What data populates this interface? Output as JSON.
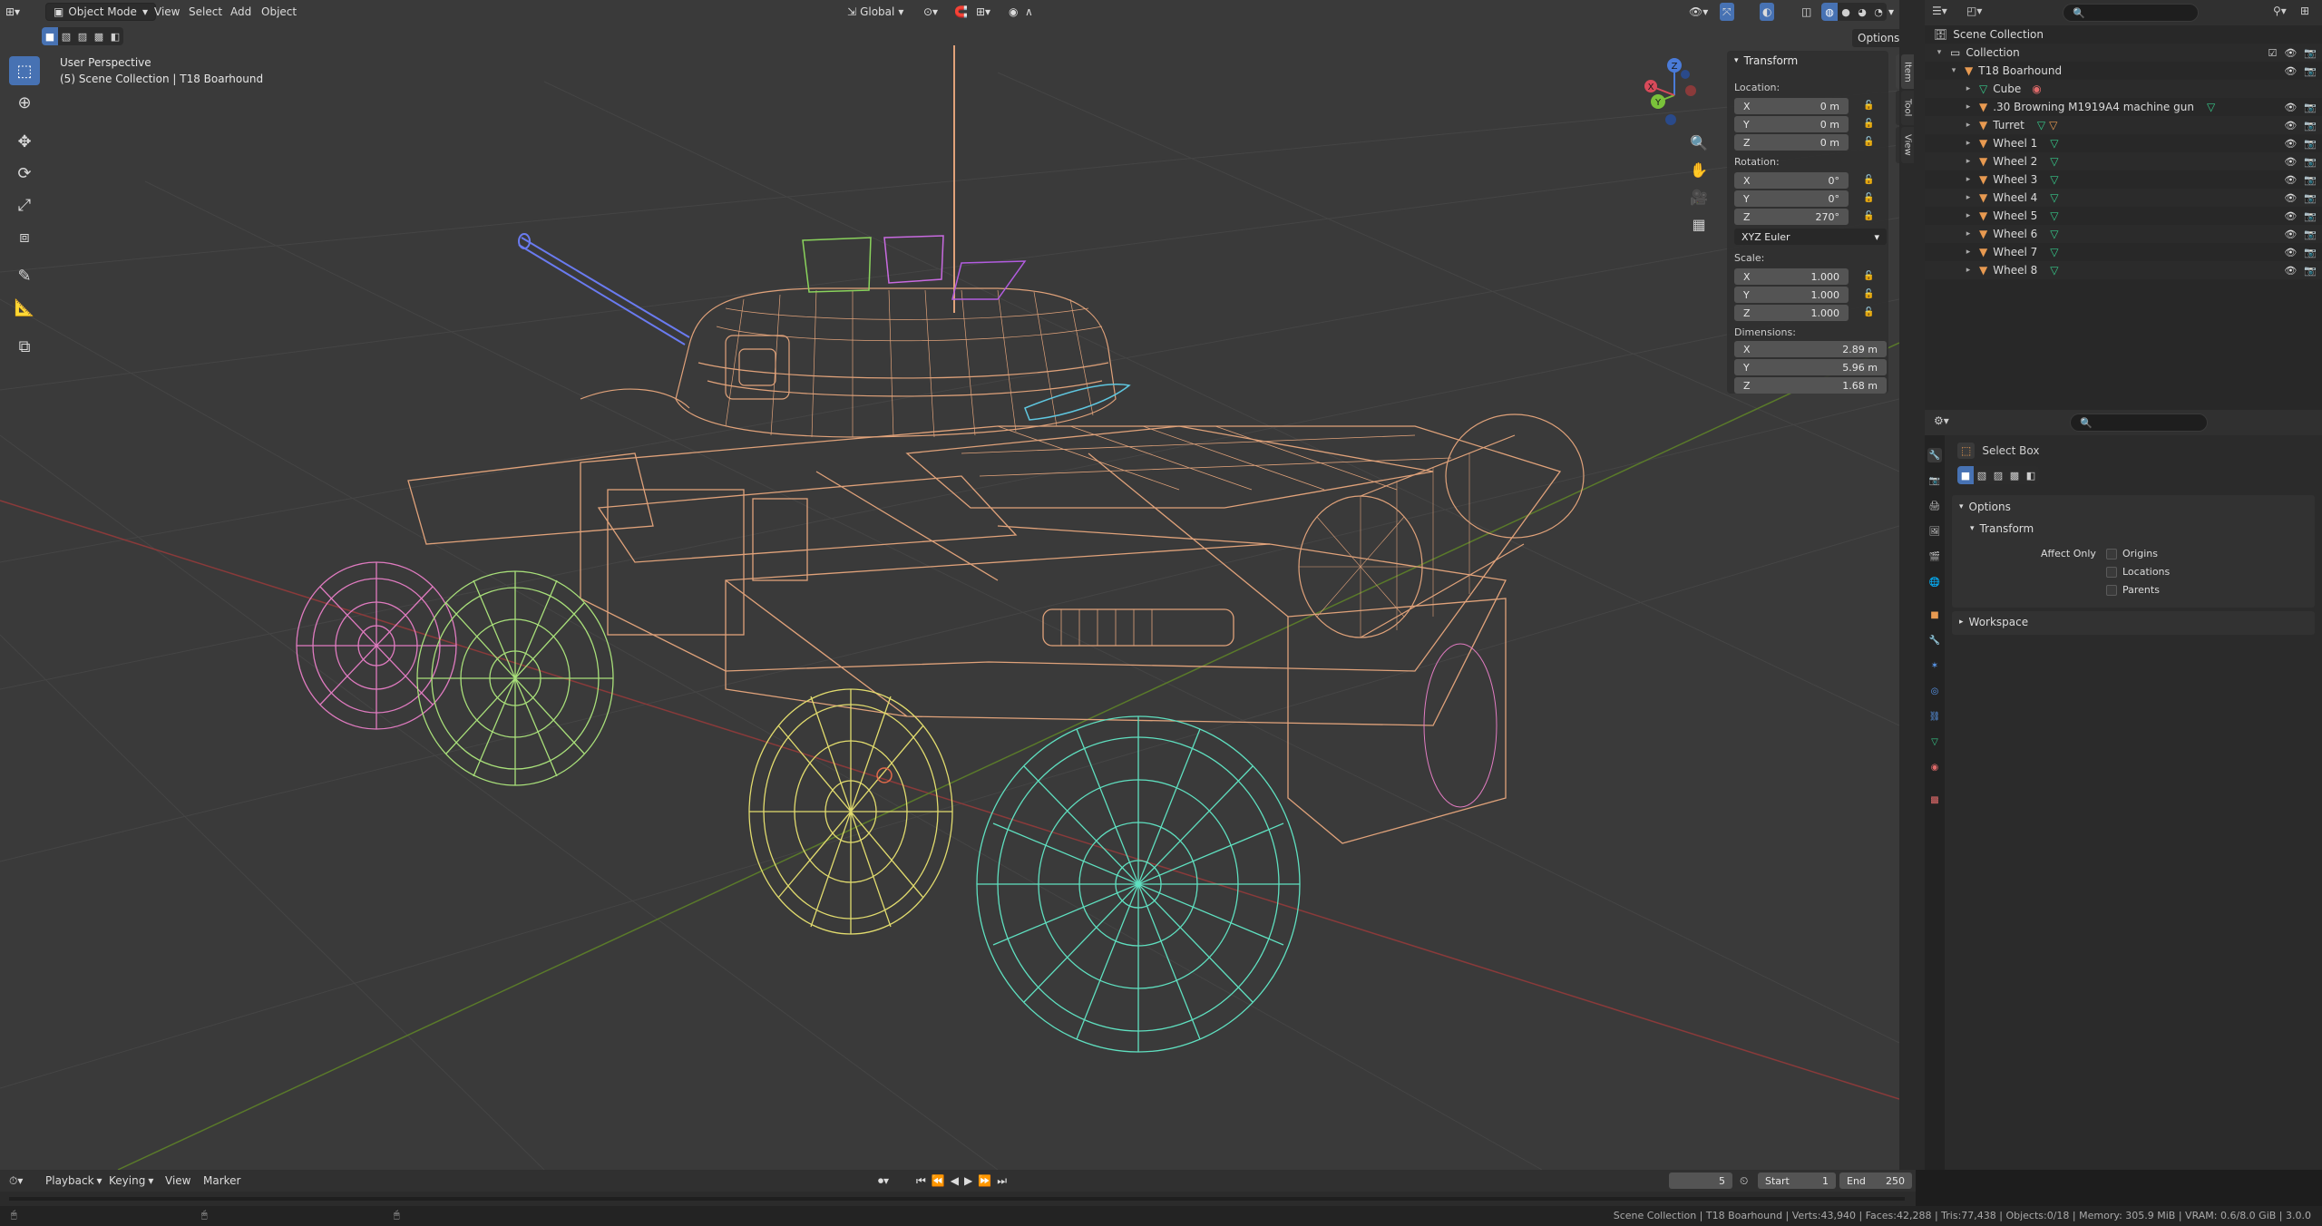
{
  "viewport": {
    "mode": "Object Mode",
    "menus": [
      "View",
      "Select",
      "Add",
      "Object"
    ],
    "orientation": "Global",
    "options_label": "Options",
    "perspective": "User Perspective",
    "context": "(5) Scene Collection | T18 Boarhound"
  },
  "toolbar": {
    "tools": [
      "select-box-icon",
      "cursor-icon",
      "move-icon",
      "rotate-icon",
      "scale-icon",
      "transform-icon",
      "annotate-icon",
      "measure-icon",
      "add-cube-icon"
    ]
  },
  "gizmo": {
    "x": "X",
    "y": "Y",
    "z": "Z"
  },
  "npanel": {
    "title": "Transform",
    "location_label": "Location:",
    "location": [
      {
        "axis": "X",
        "value": "0 m"
      },
      {
        "axis": "Y",
        "value": "0 m"
      },
      {
        "axis": "Z",
        "value": "0 m"
      }
    ],
    "rotation_label": "Rotation:",
    "rotation": [
      {
        "axis": "X",
        "value": "0°"
      },
      {
        "axis": "Y",
        "value": "0°"
      },
      {
        "axis": "Z",
        "value": "270°"
      }
    ],
    "rotation_mode": "XYZ Euler",
    "scale_label": "Scale:",
    "scale": [
      {
        "axis": "X",
        "value": "1.000"
      },
      {
        "axis": "Y",
        "value": "1.000"
      },
      {
        "axis": "Z",
        "value": "1.000"
      }
    ],
    "dimensions_label": "Dimensions:",
    "dimensions": [
      {
        "axis": "X",
        "value": "2.89 m"
      },
      {
        "axis": "Y",
        "value": "5.96 m"
      },
      {
        "axis": "Z",
        "value": "1.68 m"
      }
    ],
    "tabs": [
      "Item",
      "Tool",
      "View"
    ]
  },
  "outliner": {
    "rows": [
      {
        "label": "Scene Collection"
      },
      {
        "label": "Collection"
      },
      {
        "label": "T18 Boarhound"
      },
      {
        "label": "Cube"
      },
      {
        "label": ".30 Browning M1919A4 machine gun"
      },
      {
        "label": "Turret"
      },
      {
        "label": "Wheel 1"
      },
      {
        "label": "Wheel 2"
      },
      {
        "label": "Wheel 3"
      },
      {
        "label": "Wheel 4"
      },
      {
        "label": "Wheel 5"
      },
      {
        "label": "Wheel 6"
      },
      {
        "label": "Wheel 7"
      },
      {
        "label": "Wheel 8"
      }
    ]
  },
  "properties": {
    "tool_name": "Select Box",
    "options_label": "Options",
    "transform_label": "Transform",
    "affect_only_label": "Affect Only",
    "checkboxes": [
      "Origins",
      "Locations",
      "Parents"
    ],
    "workspace_label": "Workspace"
  },
  "timeline": {
    "menus": [
      "Playback",
      "Keying",
      "View",
      "Marker"
    ],
    "current_frame": "5",
    "start_label": "Start",
    "start": "1",
    "end_label": "End",
    "end": "250"
  },
  "statusbar": {
    "text": "Scene Collection | T18 Boarhound | Verts:43,940 | Faces:42,288 | Tris:77,438 | Objects:0/18 | Memory: 305.9 MiB | VRAM: 0.6/8.0 GiB | 3.0.0"
  },
  "colors": {
    "accent": "#4772b3",
    "wire_body": "#e0a27a",
    "wheel_pink": "#e07bc0",
    "wheel_green": "#a9e07a",
    "wheel_yellow": "#e2dc6e",
    "wheel_teal": "#5fe0c0"
  }
}
